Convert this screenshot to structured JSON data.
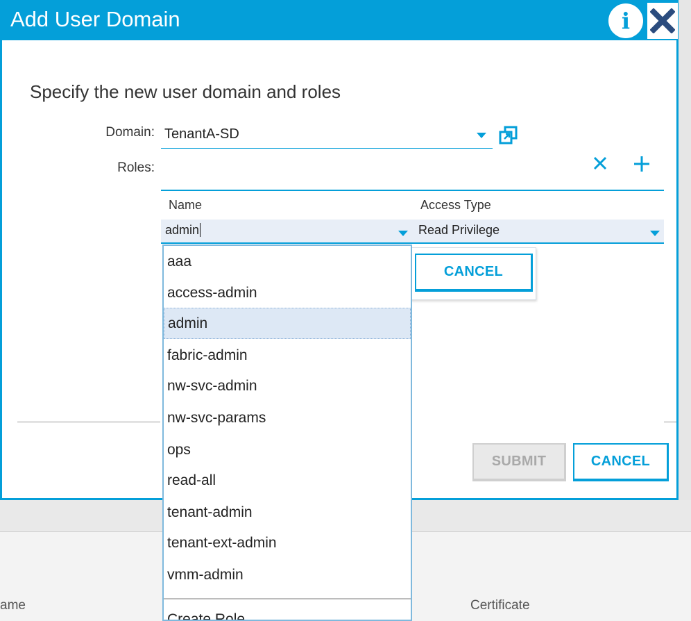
{
  "dialog": {
    "title": "Add User Domain",
    "subtitle": "Specify the new user domain and roles"
  },
  "form": {
    "domain_label": "Domain:",
    "domain_value": "TenantA-SD",
    "roles_label": "Roles:"
  },
  "roles_table": {
    "columns": [
      "Name",
      "Access Type"
    ],
    "name_value": "admin",
    "access_value": "Read Privilege"
  },
  "buttons": {
    "row_cancel": "CANCEL",
    "submit": "SUBMIT",
    "cancel": "CANCEL"
  },
  "dropdown": {
    "options": [
      "aaa",
      "access-admin",
      "admin",
      "fabric-admin",
      "nw-svc-admin",
      "nw-svc-params",
      "ops",
      "read-all",
      "tenant-admin",
      "tenant-ext-admin",
      "vmm-admin"
    ],
    "selected": "admin",
    "create_label": "Create Role"
  },
  "background": {
    "col_name": "ame",
    "col_certificate": "Certificate"
  },
  "icons": {
    "info": "info-icon",
    "close": "close-icon",
    "popout": "popout-icon",
    "delete": "x-icon",
    "add": "plus-icon",
    "caret": "chevron-down-icon"
  },
  "colors": {
    "accent": "#049fd9",
    "selected_row": "#dde8f5"
  }
}
